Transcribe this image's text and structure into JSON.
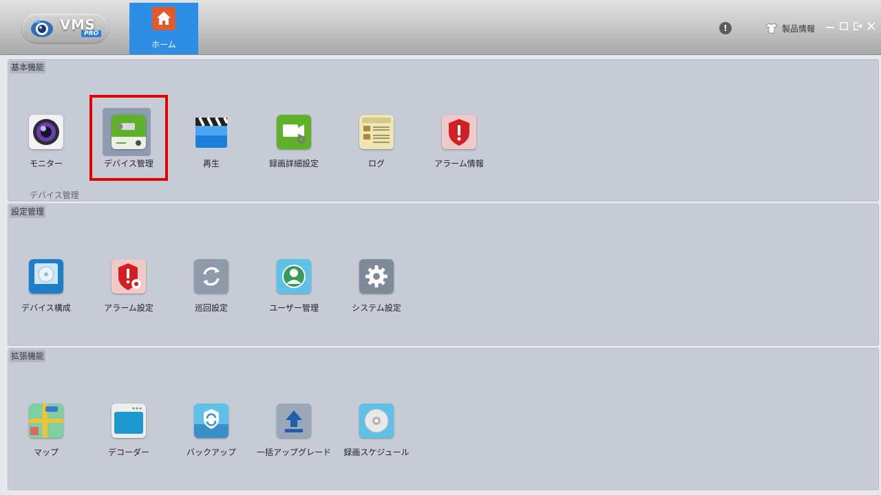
{
  "app": {
    "logo_text": "VMS",
    "logo_badge": "PRO"
  },
  "header": {
    "home_label": "ホーム",
    "product_info_label": "製品情報",
    "info_icon": "exclamation-icon"
  },
  "sections": {
    "basic": {
      "title": "基本機能",
      "hint": "デバイス管理",
      "items": [
        {
          "label": "モニター",
          "icon": "camera-lens-icon"
        },
        {
          "label": "デバイス管理",
          "icon": "device-manager-icon"
        },
        {
          "label": "再生",
          "icon": "clapperboard-icon"
        },
        {
          "label": "録画詳細設定",
          "icon": "record-settings-icon"
        },
        {
          "label": "ログ",
          "icon": "log-icon"
        },
        {
          "label": "アラーム情報",
          "icon": "alarm-shield-icon"
        }
      ]
    },
    "settings": {
      "title": "設定管理",
      "items": [
        {
          "label": "デバイス構成",
          "icon": "hard-disk-icon"
        },
        {
          "label": "アラーム設定",
          "icon": "alarm-gear-icon"
        },
        {
          "label": "巡回設定",
          "icon": "patrol-sync-icon"
        },
        {
          "label": "ユーザー管理",
          "icon": "user-icon"
        },
        {
          "label": "システム設定",
          "icon": "system-gear-icon"
        }
      ]
    },
    "extended": {
      "title": "拡張機能",
      "items": [
        {
          "label": "マップ",
          "icon": "map-icon"
        },
        {
          "label": "デコーダー",
          "icon": "decoder-icon"
        },
        {
          "label": "バックアップ",
          "icon": "backup-icon"
        },
        {
          "label": "一括アップグレード",
          "icon": "upgrade-icon"
        },
        {
          "label": "録画スケジュール",
          "icon": "disc-icon"
        }
      ]
    }
  },
  "colors": {
    "accent": "#2e8ee6",
    "panel_bg": "#c6cbd5",
    "highlight_border": "#e00000"
  }
}
